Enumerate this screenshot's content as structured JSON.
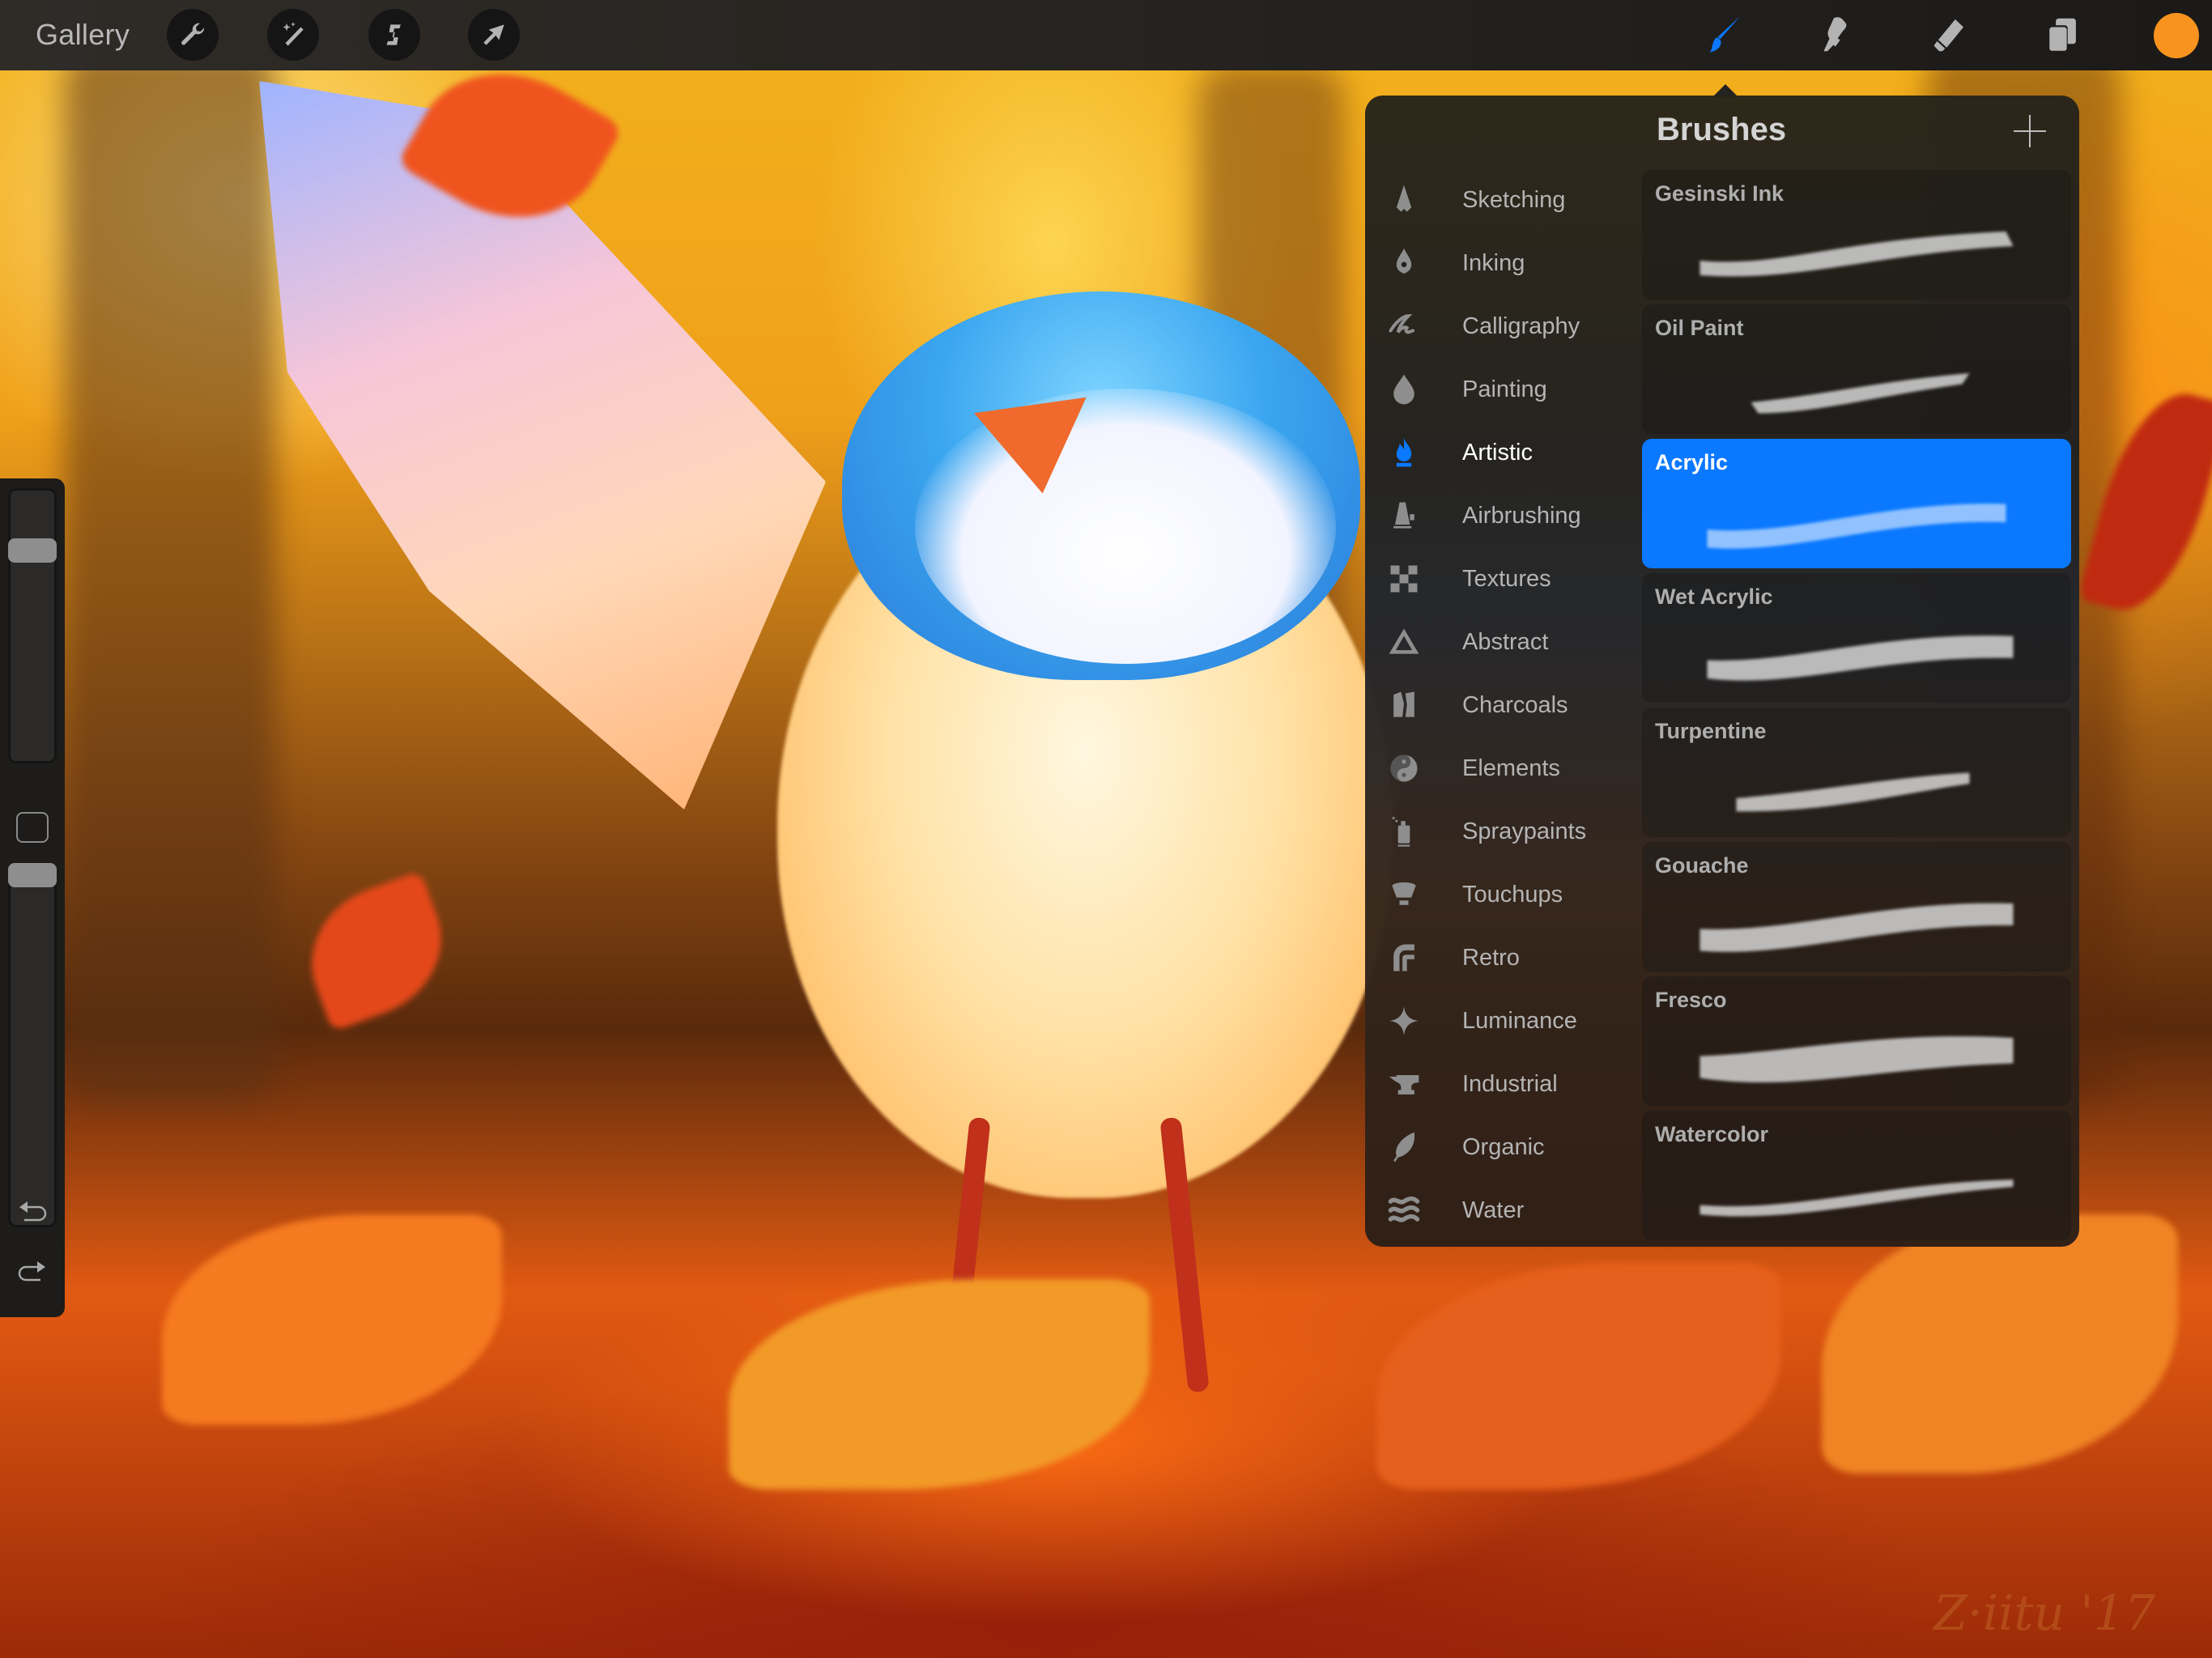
{
  "topbar": {
    "gallery_label": "Gallery",
    "left_tools": [
      {
        "name": "actions",
        "icon": "wrench-icon"
      },
      {
        "name": "adjustments",
        "icon": "magic-wand-icon"
      },
      {
        "name": "selection",
        "icon": "selection-s-icon"
      },
      {
        "name": "transform",
        "icon": "arrow-cursor-icon"
      }
    ],
    "right_tools": [
      {
        "name": "brush",
        "icon": "paintbrush-icon",
        "active": true
      },
      {
        "name": "smudge",
        "icon": "smudge-finger-icon"
      },
      {
        "name": "eraser",
        "icon": "eraser-icon"
      },
      {
        "name": "layers",
        "icon": "layers-icon"
      },
      {
        "name": "color",
        "icon": "color-swatch"
      }
    ],
    "accent_color": "#0a78ff",
    "current_color": "#f7931e"
  },
  "sidebar": {
    "brush_size": 0.8,
    "opacity": 1.0,
    "modify_button": "square-modify-icon",
    "undo_icon": "undo-icon",
    "redo_icon": "redo-icon"
  },
  "brushes_panel": {
    "title": "Brushes",
    "add_icon": "plus-icon",
    "sets": [
      {
        "label": "Sketching",
        "icon": "pencil-tip-icon"
      },
      {
        "label": "Inking",
        "icon": "pen-nib-icon"
      },
      {
        "label": "Calligraphy",
        "icon": "calligraphy-stroke-icon"
      },
      {
        "label": "Painting",
        "icon": "drop-icon"
      },
      {
        "label": "Artistic",
        "icon": "flame-icon",
        "active": true
      },
      {
        "label": "Airbrushing",
        "icon": "airbrush-icon"
      },
      {
        "label": "Textures",
        "icon": "checkerboard-icon"
      },
      {
        "label": "Abstract",
        "icon": "triangle-icon"
      },
      {
        "label": "Charcoals",
        "icon": "charcoal-icon"
      },
      {
        "label": "Elements",
        "icon": "yin-yang-icon"
      },
      {
        "label": "Spraypaints",
        "icon": "spray-can-icon"
      },
      {
        "label": "Touchups",
        "icon": "makeup-brush-icon"
      },
      {
        "label": "Retro",
        "icon": "retro-arches-icon"
      },
      {
        "label": "Luminance",
        "icon": "sparkle-icon"
      },
      {
        "label": "Industrial",
        "icon": "anvil-icon"
      },
      {
        "label": "Organic",
        "icon": "leaf-icon"
      },
      {
        "label": "Water",
        "icon": "waves-icon"
      }
    ],
    "brushes": [
      {
        "label": "Gesinski Ink"
      },
      {
        "label": "Oil Paint"
      },
      {
        "label": "Acrylic",
        "active": true
      },
      {
        "label": "Wet Acrylic"
      },
      {
        "label": "Turpentine"
      },
      {
        "label": "Gouache"
      },
      {
        "label": "Fresco"
      },
      {
        "label": "Watercolor"
      }
    ]
  },
  "canvas": {
    "signature": "Z·iitu '17"
  }
}
